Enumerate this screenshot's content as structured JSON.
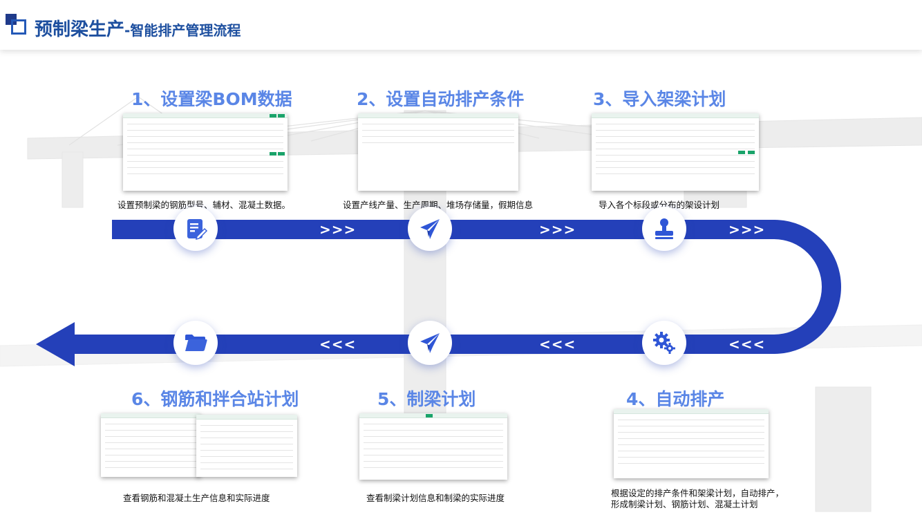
{
  "header": {
    "title_main": "预制梁生产",
    "title_sub": "-智能排产管理流程"
  },
  "steps": [
    {
      "title": "1、设置梁BOM数据",
      "desc": "设置预制梁的钢筋型号、辅材、混凝土数据。",
      "icon": "edit-document-icon"
    },
    {
      "title": "2、设置自动排产条件",
      "desc": "设置产线产量、生产周期、堆场存储量，假期信息",
      "icon": "paper-plane-icon"
    },
    {
      "title": "3、导入架梁计划",
      "desc": "导入各个标段或分布的架设计划",
      "icon": "stamp-icon"
    },
    {
      "title": "4、自动排产",
      "desc_line1": "根据设定的排产条件和架梁计划，自动排产，",
      "desc_line2": "形成制梁计划、钢筋计划、混凝土计划",
      "icon": "gears-icon"
    },
    {
      "title": "5、制梁计划",
      "desc": "查看制梁计划信息和制梁的实际进度",
      "icon": "paper-plane-icon"
    },
    {
      "title": "6、钢筋和拌合站计划",
      "desc": "查看钢筋和混凝土生产信息和实际进度",
      "icon": "folder-icon"
    }
  ],
  "flow": {
    "forward_arrows": ">>>",
    "backward_arrows": "<<<"
  },
  "colors": {
    "road": "#2440b9",
    "title_blue": "#1d4f9f",
    "step_title": "#5a86e6",
    "icon_blue": "#2f56d6"
  }
}
